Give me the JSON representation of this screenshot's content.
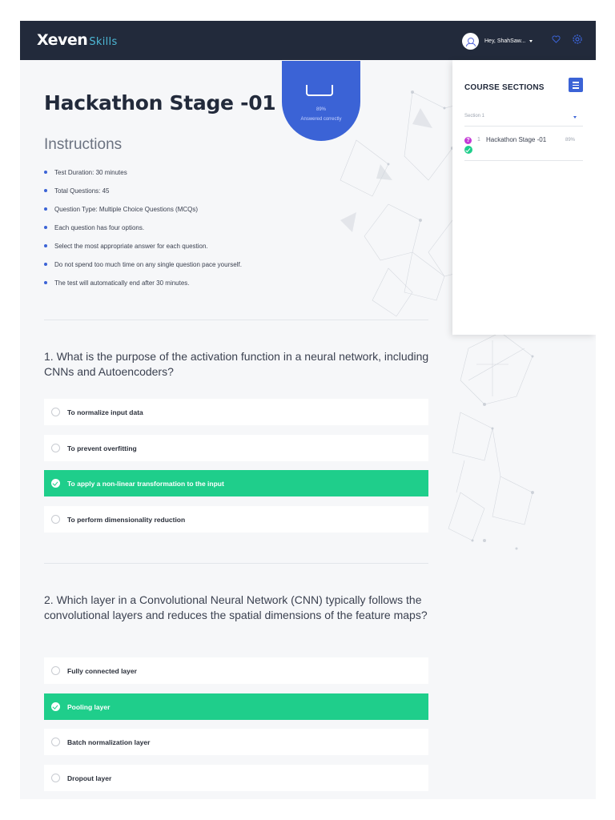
{
  "header": {
    "logo_x": "Xeven",
    "logo_skills": "Skills",
    "greeting": "Hey, ShahSaw..."
  },
  "quiz": {
    "title": "Hackathon Stage -01",
    "score_percent": "89%",
    "score_caption": "Answered correctly",
    "instructions_title": "Instructions",
    "instructions": [
      "Test Duration: 30 minutes",
      "Total Questions: 45",
      "Question Type: Multiple Choice Questions (MCQs)",
      "Each question has four options.",
      "Select the most appropriate answer for each question.",
      "Do not spend too much time on any single question pace yourself.",
      "The test will automatically end after 30 minutes."
    ]
  },
  "questions": [
    {
      "text": "1. What is the purpose of the activation function in a neural network, including CNNs and Autoencoders?",
      "options": [
        "To normalize input data",
        "To prevent overfitting",
        "To apply a non-linear transformation to the input",
        "To perform dimensionality reduction"
      ],
      "selected_index": 2
    },
    {
      "text": "2. Which layer in a Convolutional Neural Network (CNN) typically follows the convolutional layers and reduces the spatial dimensions of the feature maps?",
      "options": [
        "Fully connected layer",
        "Pooling layer",
        "Batch normalization layer",
        "Dropout layer"
      ],
      "selected_index": 1
    }
  ],
  "sidebar": {
    "title": "COURSE SECTIONS",
    "section_select": "Section 1",
    "items": [
      {
        "number": "1",
        "label": "Hackathon Stage -01",
        "percent": "89%"
      }
    ]
  },
  "colors": {
    "topbar": "#222a3b",
    "accent": "#3b63d6",
    "correct": "#1fce8b",
    "skills_text": "#4db8d6"
  },
  "icons": [
    "user-avatar-icon",
    "heart-icon",
    "gear-icon",
    "list-icon",
    "question-mark-icon",
    "check-circle-icon",
    "radio-icon"
  ]
}
